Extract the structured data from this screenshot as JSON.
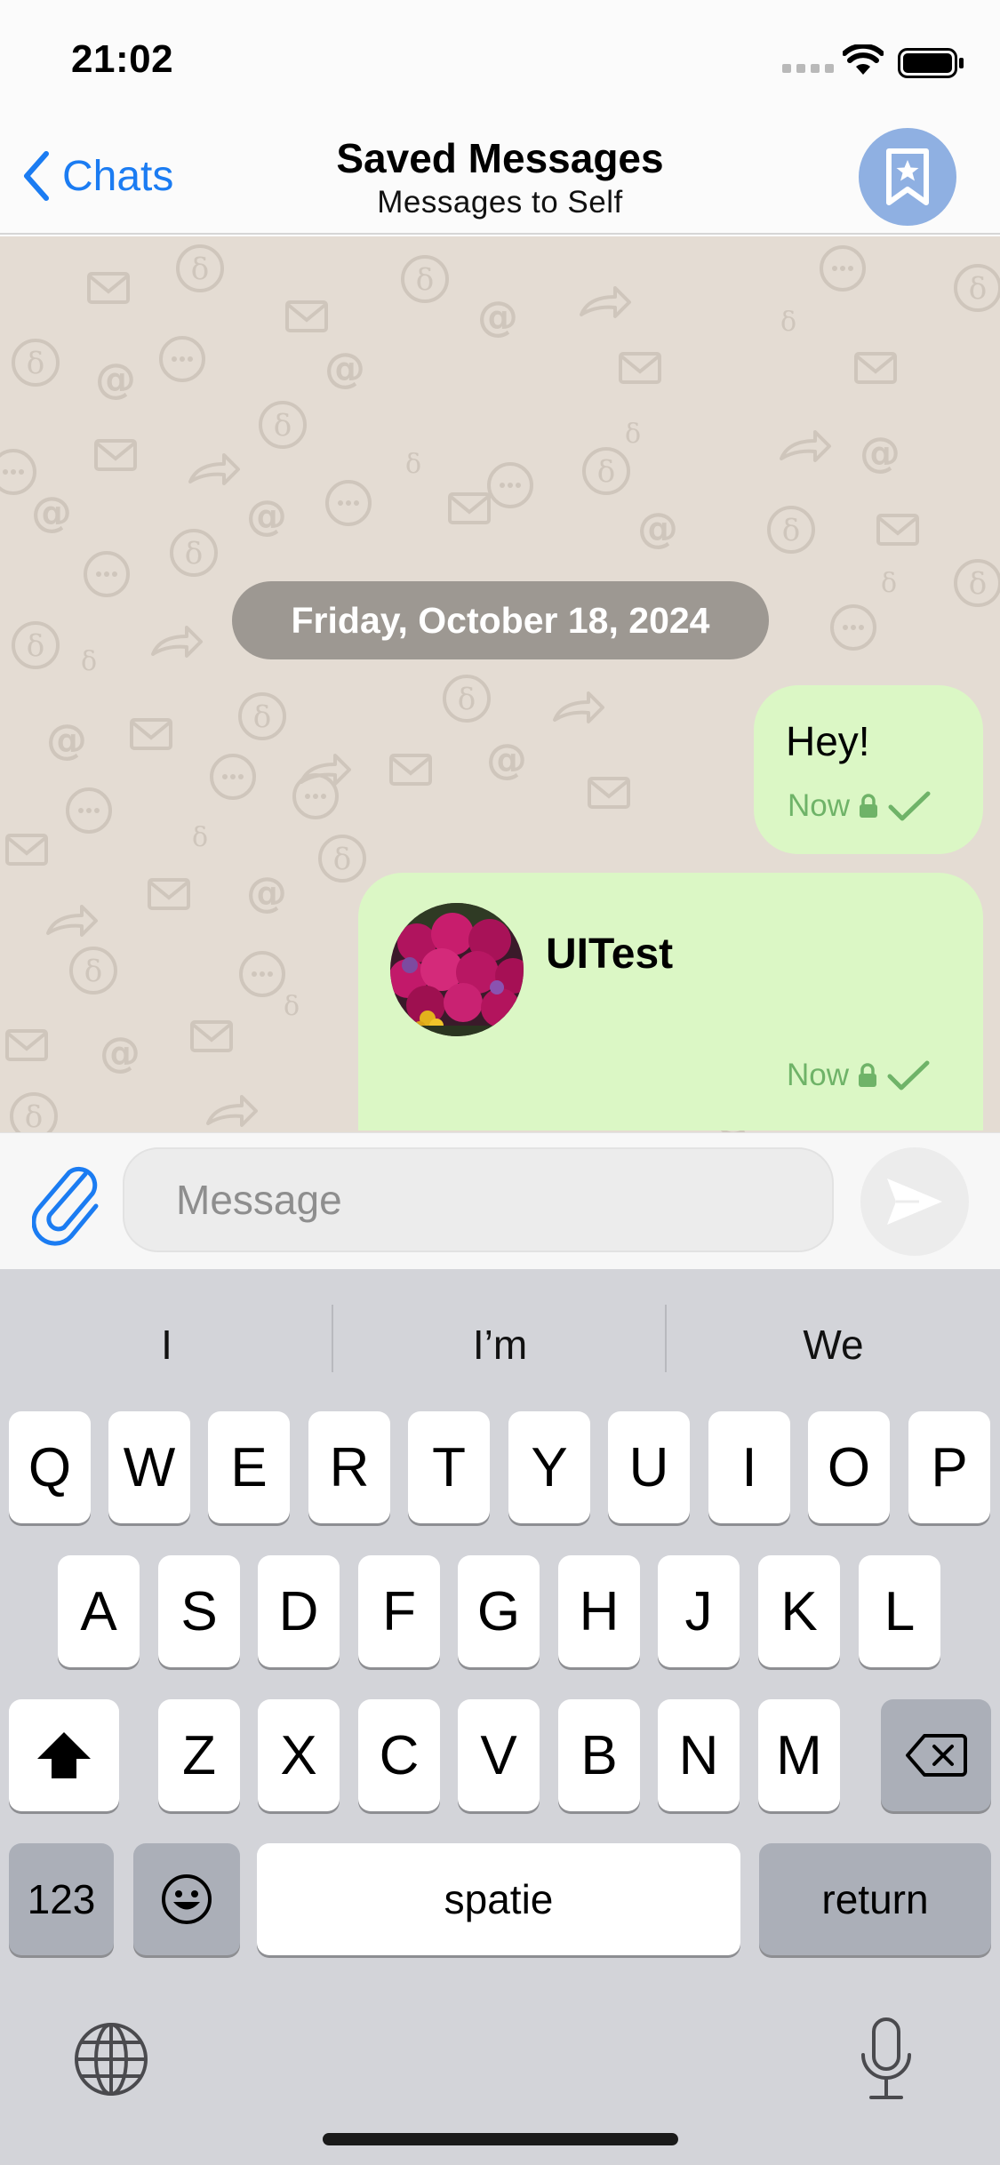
{
  "status_bar": {
    "time": "21:02"
  },
  "nav": {
    "back_label": "Chats",
    "title": "Saved Messages",
    "subtitle": "Messages to Self"
  },
  "chat": {
    "date_label": "Friday, October 18, 2024",
    "messages": [
      {
        "type": "text",
        "text": "Hey!",
        "time": "Now",
        "bubble_color": "#dbf7c5"
      },
      {
        "type": "contact",
        "name": "UITest",
        "time": "Now",
        "bubble_color": "#dbf7c5"
      }
    ]
  },
  "composer": {
    "placeholder": "Message"
  },
  "keyboard": {
    "suggestions": [
      "I",
      "I’m",
      "We"
    ],
    "row1": [
      "Q",
      "W",
      "E",
      "R",
      "T",
      "Y",
      "U",
      "I",
      "O",
      "P"
    ],
    "row2": [
      "A",
      "S",
      "D",
      "F",
      "G",
      "H",
      "J",
      "K",
      "L"
    ],
    "row3": [
      "Z",
      "X",
      "C",
      "V",
      "B",
      "N",
      "M"
    ],
    "numbers_label": "123",
    "space_label": "spatie",
    "return_label": "return"
  },
  "colors": {
    "accent": "#1b7cf2",
    "outgoing_bubble": "#dbf7c5",
    "check": "#6fb368",
    "chat_background": "#e4dcd3",
    "avatar": "#8fb0e2"
  },
  "icons": [
    "chevron-left-icon",
    "bookmark-star-icon",
    "lock-icon",
    "checkmark-icon",
    "paperclip-icon",
    "send-icon",
    "shift-icon",
    "backspace-icon",
    "emoji-icon",
    "globe-icon",
    "microphone-icon",
    "wifi-icon",
    "battery-icon"
  ]
}
